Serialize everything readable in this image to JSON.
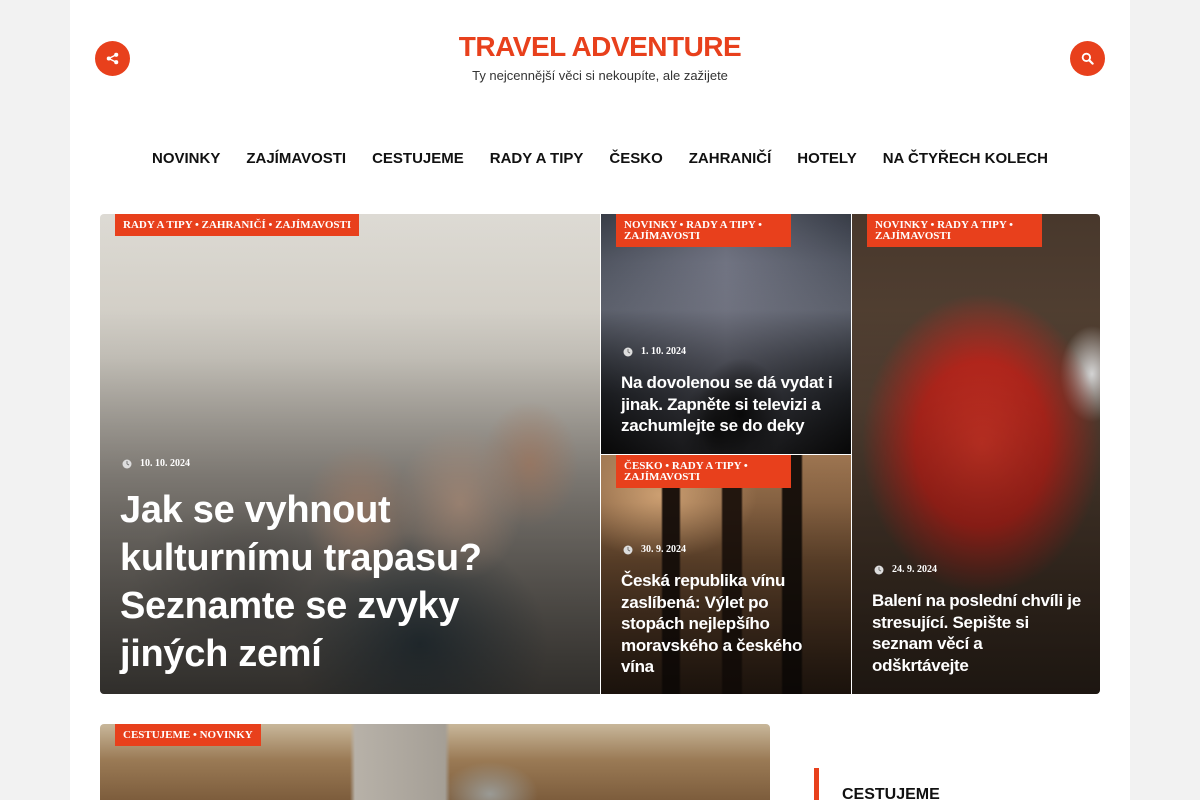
{
  "header": {
    "site_title": "TRAVEL ADVENTURE",
    "tagline": "Ty nejcennější věci si nekoupíte, ale zažijete",
    "share_icon": "share-icon",
    "search_icon": "search-icon"
  },
  "colors": {
    "accent": "#e8401c",
    "text": "#111111",
    "background": "#ffffff"
  },
  "nav": {
    "items": [
      {
        "label": "NOVINKY"
      },
      {
        "label": "ZAJÍMAVOSTI"
      },
      {
        "label": "CESTUJEME"
      },
      {
        "label": "RADY A TIPY"
      },
      {
        "label": "ČESKO"
      },
      {
        "label": "ZAHRANIČÍ"
      },
      {
        "label": "HOTELY"
      },
      {
        "label": "NA ČTYŘECH KOLECH"
      }
    ]
  },
  "featured": [
    {
      "tags": "RADY A TIPY • ZAHRANIČÍ • ZAJÍMAVOSTI",
      "date": "10. 10. 2024",
      "title": "Jak se vyhnout kulturnímu trapasu? Seznamte se zvyky jiných zemí"
    },
    {
      "tags": "NOVINKY • RADY A TIPY • ZAJÍMAVOSTI",
      "date": "1. 10. 2024",
      "title": "Na dovolenou se dá vydat i jinak. Zapněte si televizi a zachumlejte se do deky"
    },
    {
      "tags": "ČESKO • RADY A TIPY • ZAJÍMAVOSTI",
      "date": "30. 9. 2024",
      "title": "Česká republika vínu zaslíbená: Výlet po stopách nejlepšího moravského a českého vína"
    },
    {
      "tags": "NOVINKY • RADY A TIPY • ZAJÍMAVOSTI",
      "date": "24. 9. 2024",
      "title": "Balení na poslední chvíli je stresující. Sepište si seznam věcí a odškrtávejte"
    }
  ],
  "bottom_card": {
    "tags": "CESTUJEME • NOVINKY"
  },
  "sidebar": {
    "heading": "CESTUJEME"
  }
}
